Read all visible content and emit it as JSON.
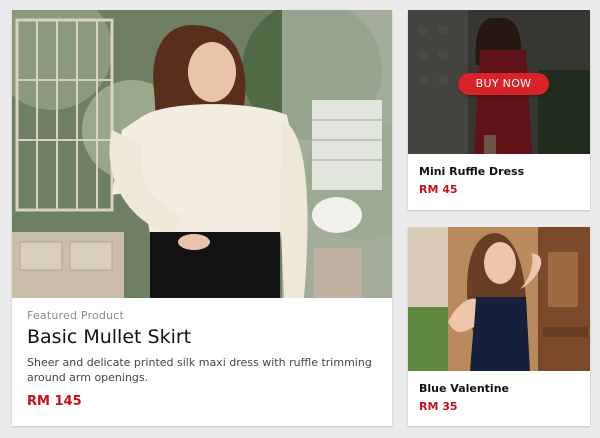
{
  "featured": {
    "kicker": "Featured Product",
    "title": "Basic Mullet Skirt",
    "description": "Sheer and delicate printed silk maxi dress with ruffle trimming around arm openings.",
    "price": "RM 145"
  },
  "products": [
    {
      "name": "Mini Ruffle Dress",
      "price": "RM 45",
      "cta": "BUY NOW"
    },
    {
      "name": "Blue Valentine",
      "price": "RM 35"
    }
  ],
  "colors": {
    "accent": "#c8101a",
    "button": "#d8222a",
    "background": "#ebebeb"
  }
}
